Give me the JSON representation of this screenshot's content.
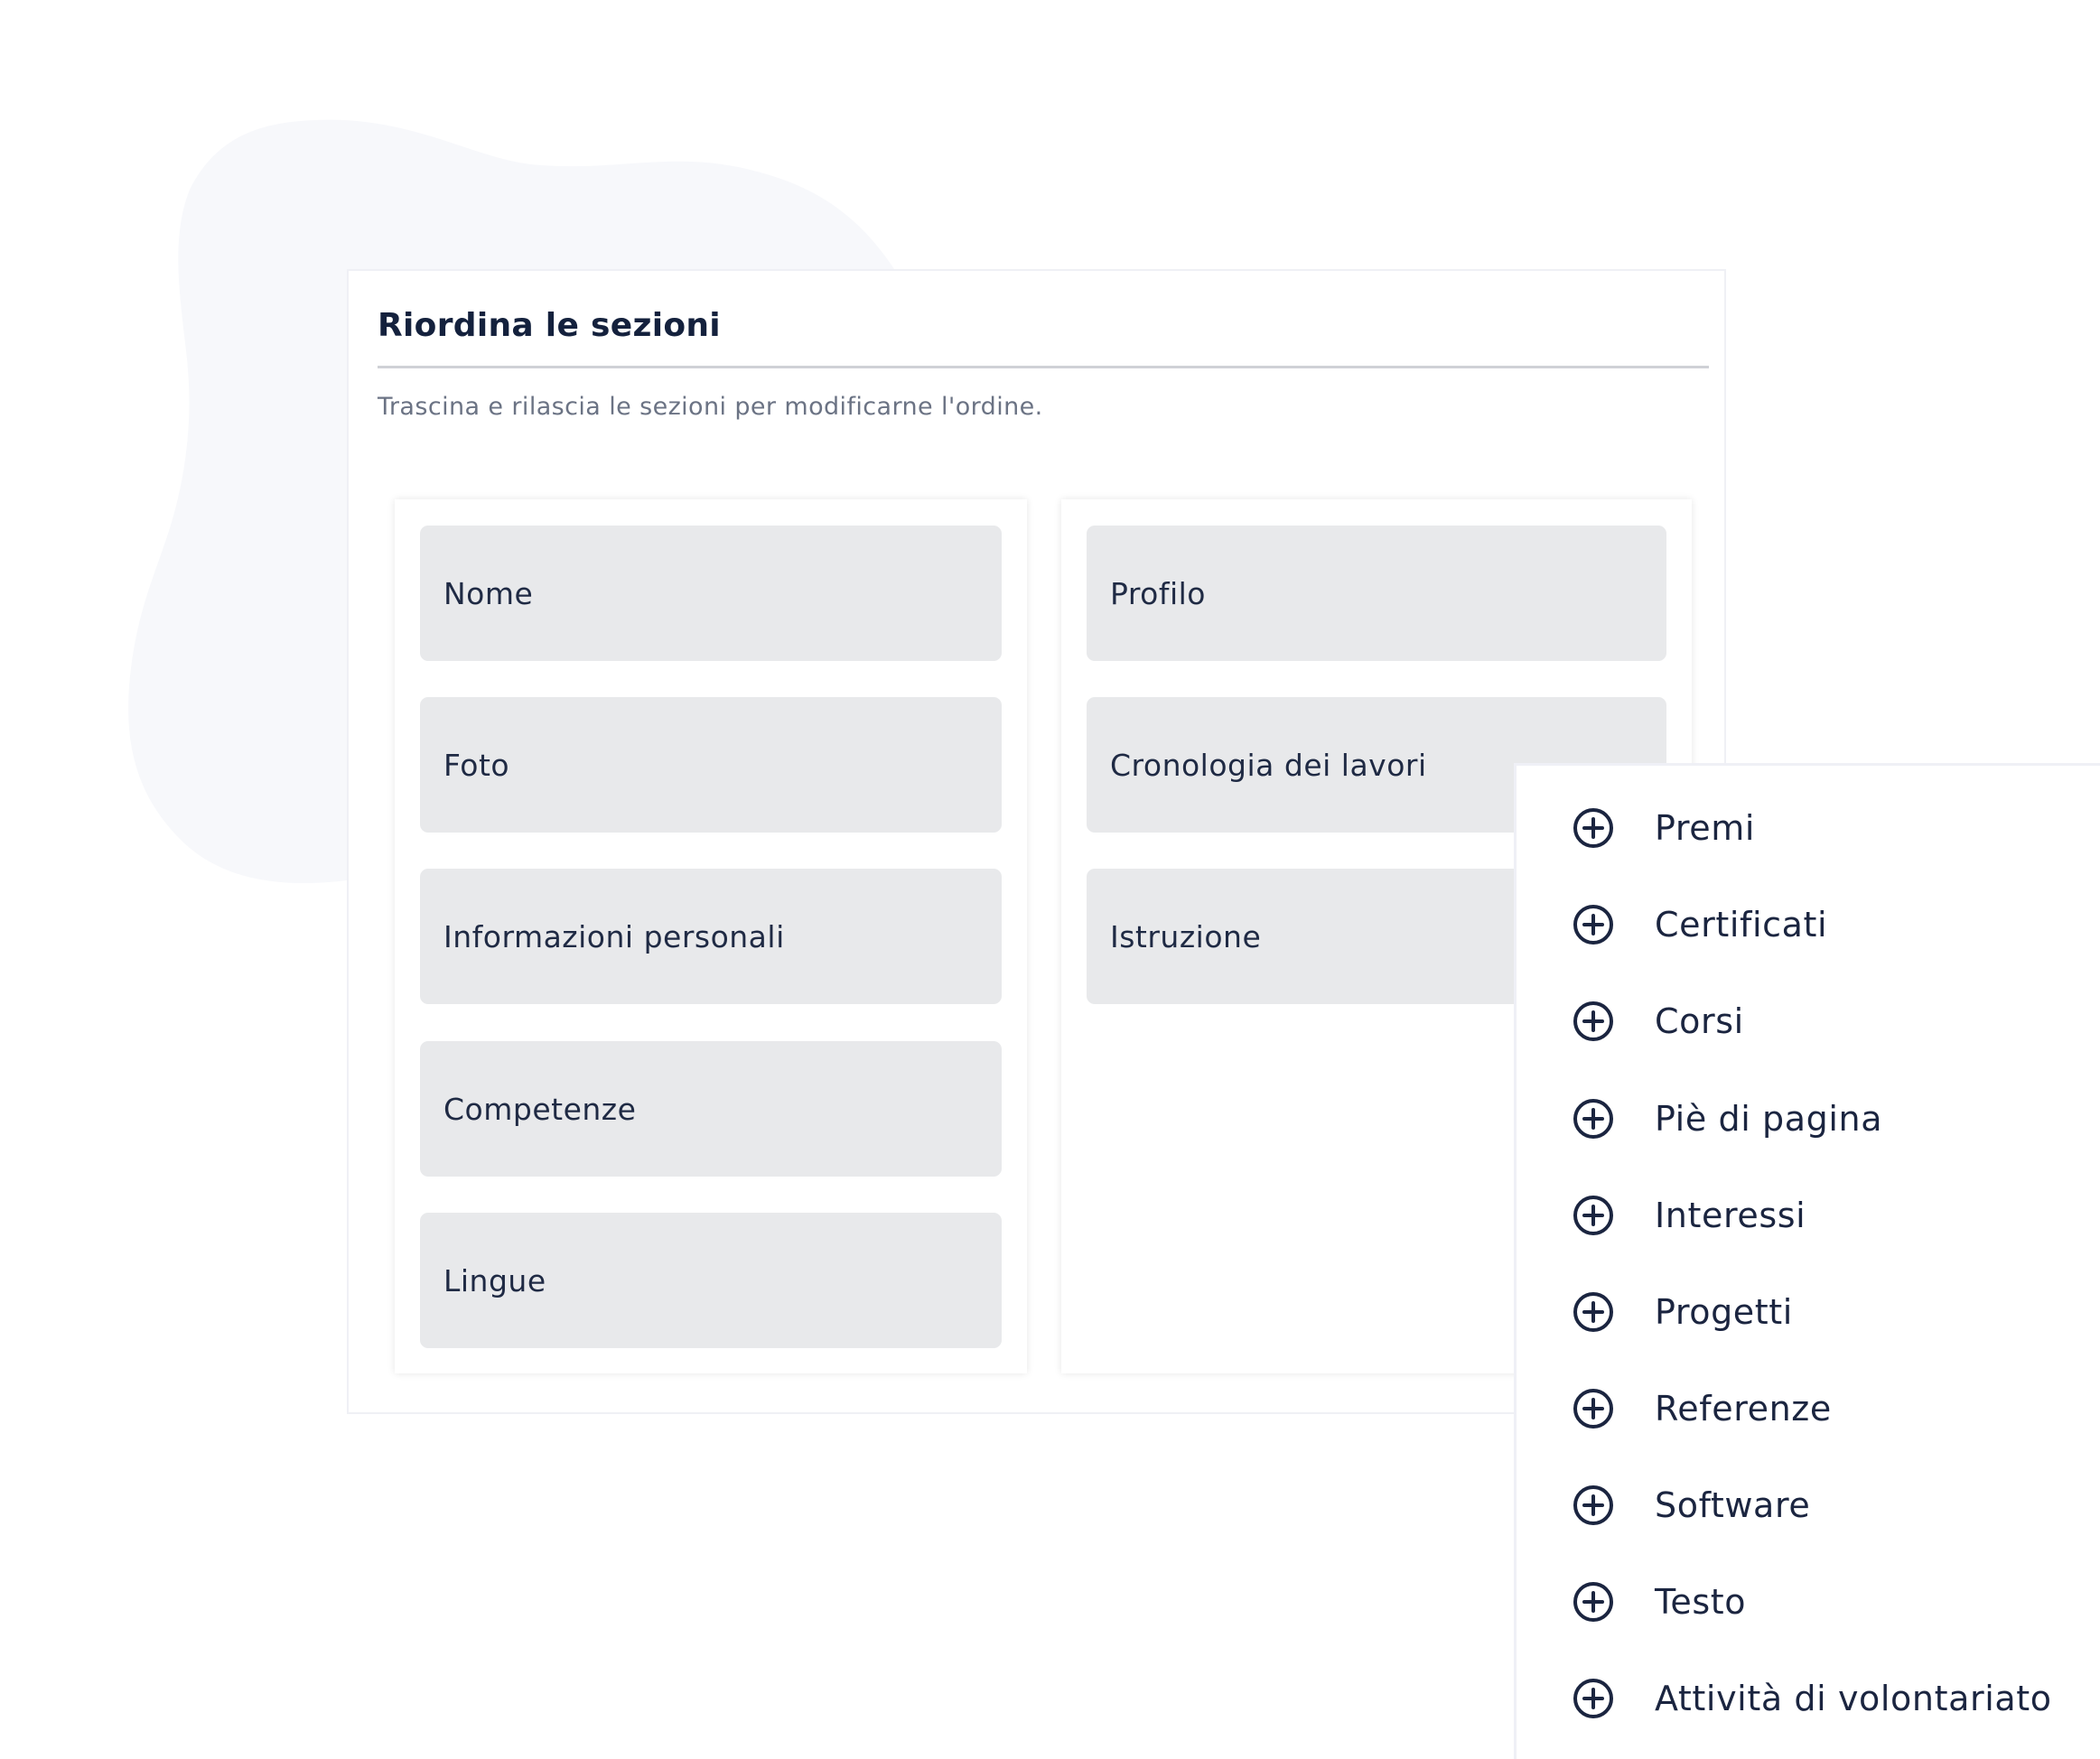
{
  "panel": {
    "title": "Riordina le sezioni",
    "subtitle": "Trascina e rilascia le sezioni per modificarne l'ordine."
  },
  "columns": {
    "left": {
      "cards": [
        {
          "label": "Nome"
        },
        {
          "label": "Foto"
        },
        {
          "label": "Informazioni personali"
        },
        {
          "label": "Competenze"
        },
        {
          "label": "Lingue"
        }
      ]
    },
    "right": {
      "cards": [
        {
          "label": "Profilo"
        },
        {
          "label": "Cronologia dei lavori"
        },
        {
          "label": "Istruzione"
        }
      ]
    }
  },
  "add_section_menu": {
    "icon": "plus-circle-icon",
    "items": [
      {
        "label": "Premi"
      },
      {
        "label": "Certificati"
      },
      {
        "label": "Corsi"
      },
      {
        "label": "Piè di pagina"
      },
      {
        "label": "Interessi"
      },
      {
        "label": "Progetti"
      },
      {
        "label": "Referenze"
      },
      {
        "label": "Software"
      },
      {
        "label": "Testo"
      },
      {
        "label": "Attività di volontariato"
      }
    ]
  },
  "colors": {
    "background_blob": "#f7f8fb",
    "card_fill": "#e8e9eb",
    "text_primary": "#1b2540",
    "text_secondary": "#6b7384",
    "divider": "#cfd1d6"
  }
}
